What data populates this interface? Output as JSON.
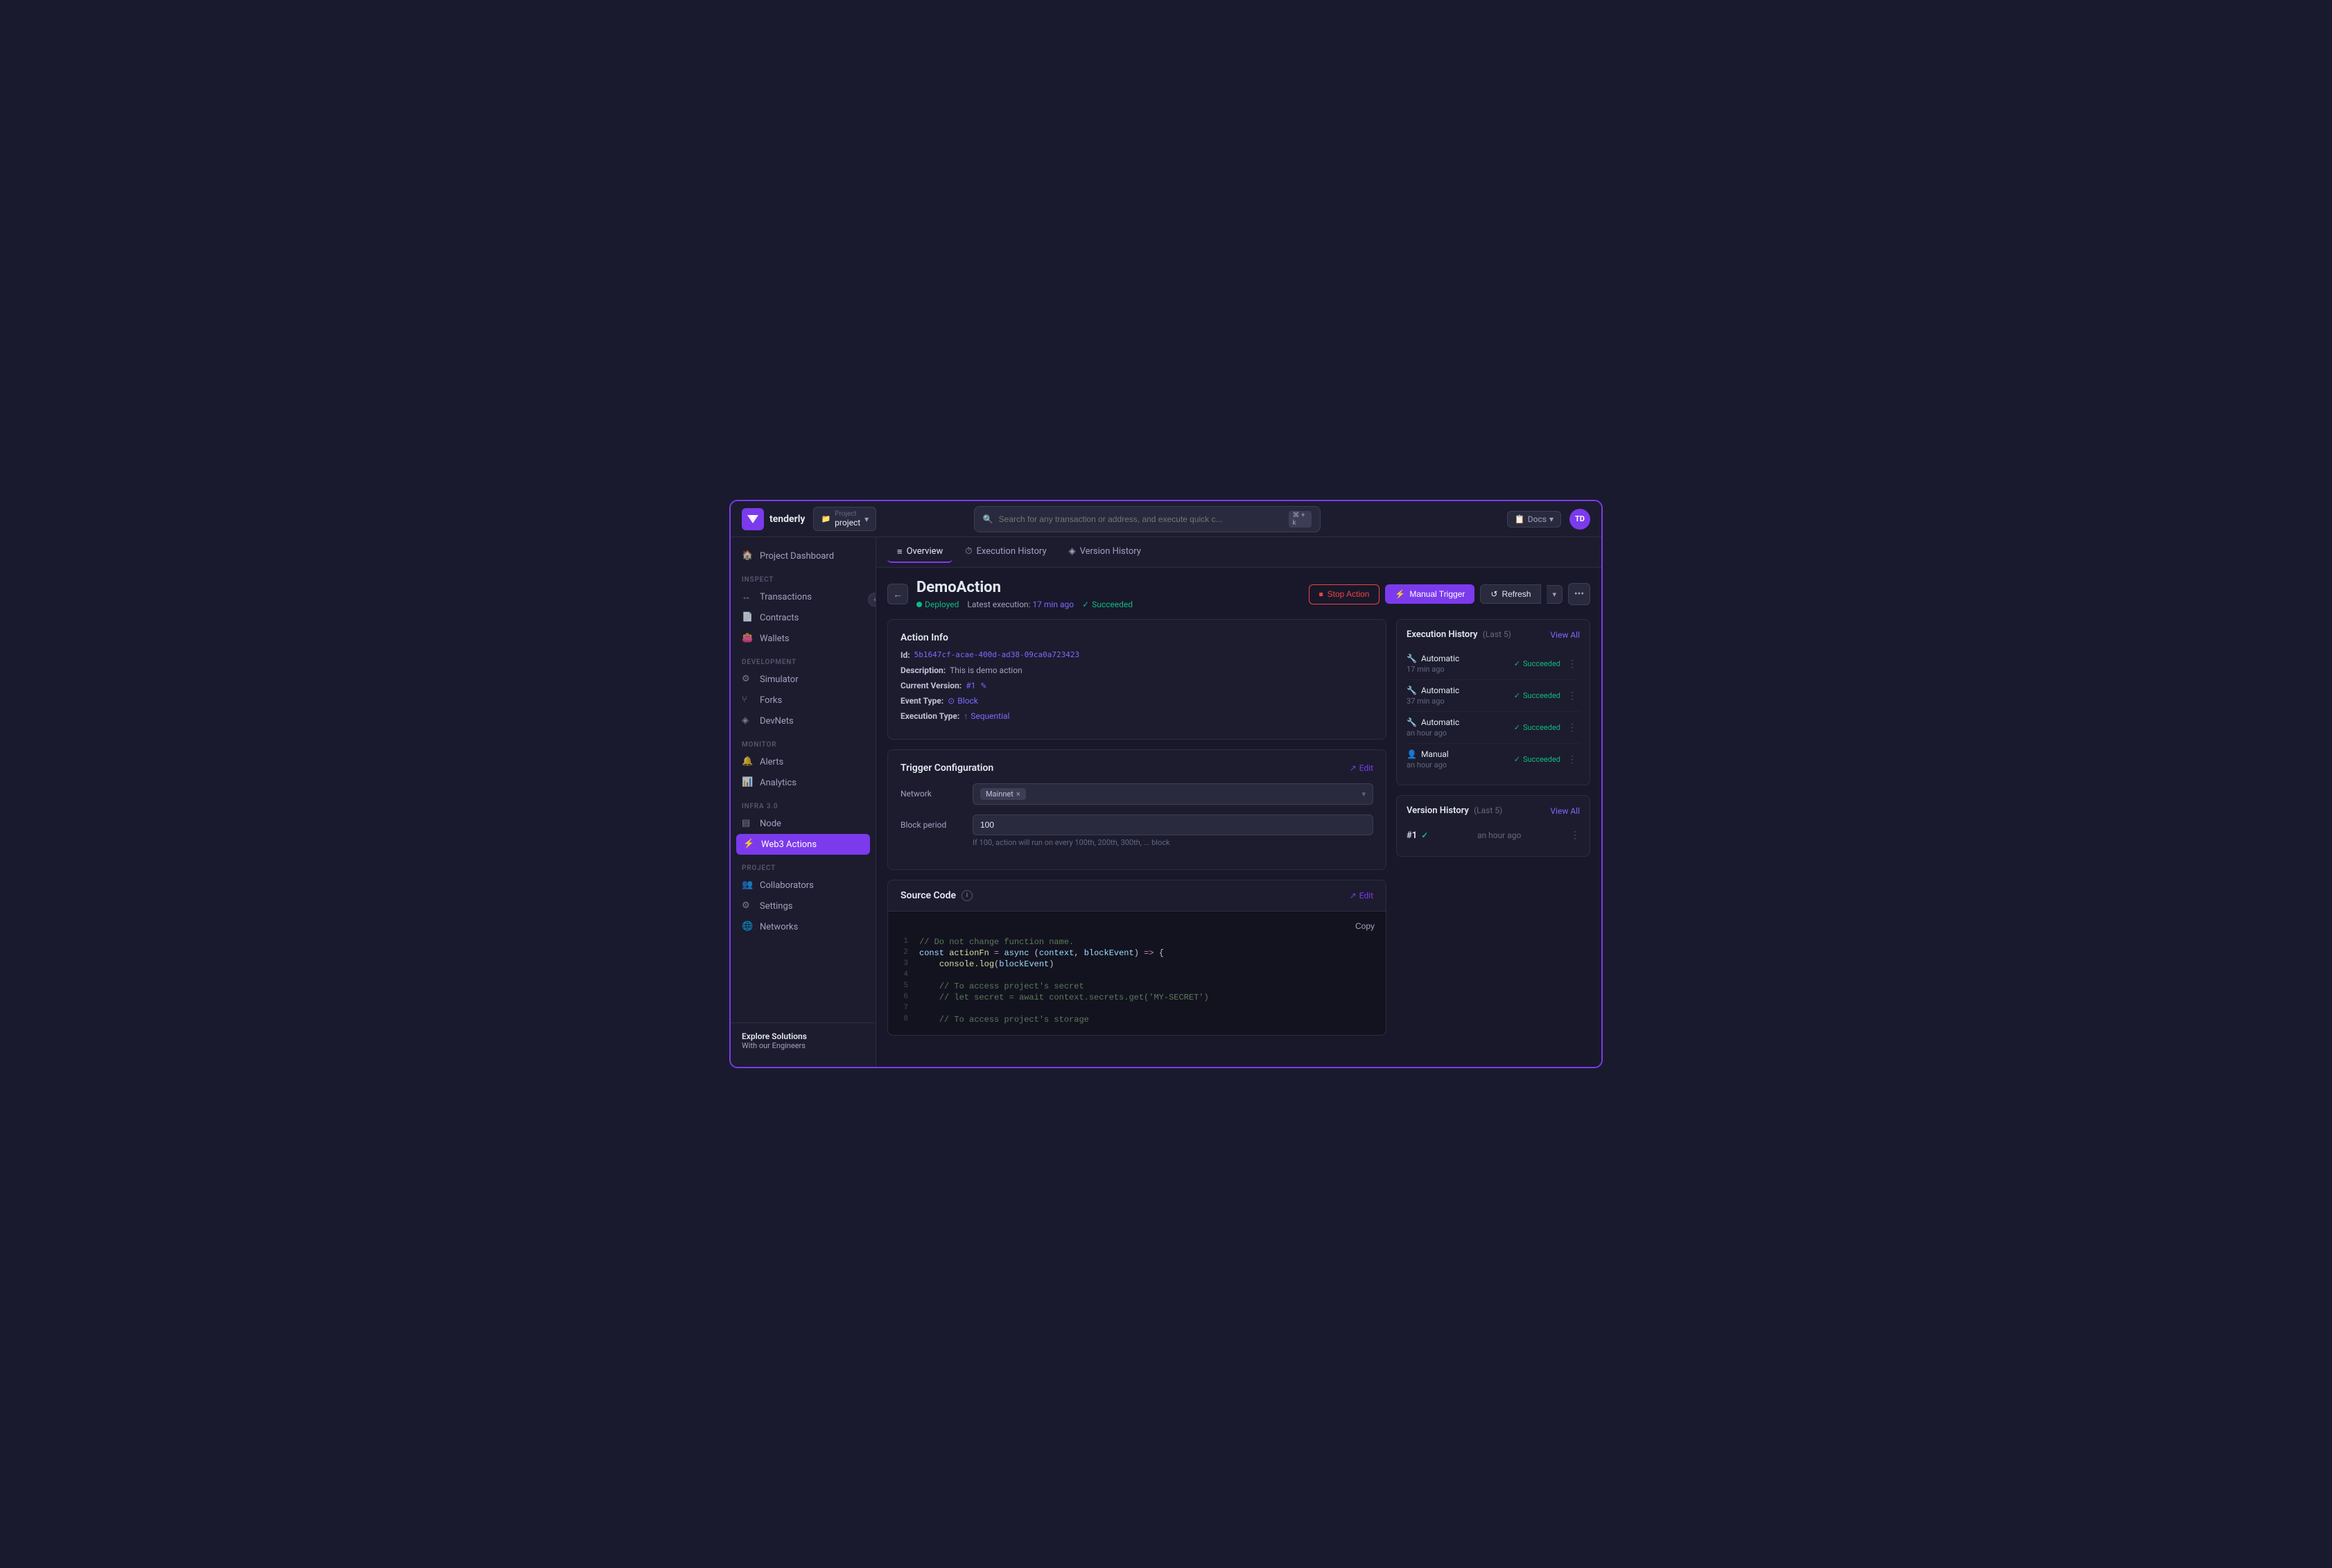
{
  "app": {
    "title": "Tenderly",
    "logo_text": "tenderly"
  },
  "project": {
    "label": "Project",
    "name": "project",
    "dropdown_icon": "▾"
  },
  "topbar": {
    "search_placeholder": "Search for any transaction or address, and execute quick c...",
    "keyboard_shortcut": "⌘ + k",
    "docs_label": "Docs",
    "docs_chevron": "▾",
    "avatar_initials": "TD"
  },
  "sidebar": {
    "collapse_icon": "‹",
    "sections": [
      {
        "label": "",
        "items": [
          {
            "id": "project-dashboard",
            "label": "Project Dashboard",
            "icon": "🏠"
          }
        ]
      },
      {
        "label": "Inspect",
        "items": [
          {
            "id": "transactions",
            "label": "Transactions",
            "icon": "↔"
          },
          {
            "id": "contracts",
            "label": "Contracts",
            "icon": "📄"
          },
          {
            "id": "wallets",
            "label": "Wallets",
            "icon": "👛"
          }
        ]
      },
      {
        "label": "Development",
        "items": [
          {
            "id": "simulator",
            "label": "Simulator",
            "icon": "⚙"
          },
          {
            "id": "forks",
            "label": "Forks",
            "icon": "⑂"
          },
          {
            "id": "devnets",
            "label": "DevNets",
            "icon": "◈"
          }
        ]
      },
      {
        "label": "Monitor",
        "items": [
          {
            "id": "alerts",
            "label": "Alerts",
            "icon": "🔔"
          },
          {
            "id": "analytics",
            "label": "Analytics",
            "icon": "📊"
          }
        ]
      },
      {
        "label": "Infra 3.0",
        "items": [
          {
            "id": "node",
            "label": "Node",
            "icon": "▤"
          },
          {
            "id": "web3-actions",
            "label": "Web3 Actions",
            "icon": "⚡",
            "active": true
          }
        ]
      },
      {
        "label": "Project",
        "items": [
          {
            "id": "collaborators",
            "label": "Collaborators",
            "icon": "👥"
          },
          {
            "id": "settings",
            "label": "Settings",
            "icon": "⚙"
          },
          {
            "id": "networks",
            "label": "Networks",
            "icon": "🌐"
          }
        ]
      }
    ],
    "explore": {
      "title": "Explore Solutions",
      "subtitle": "With our Engineers"
    }
  },
  "tabs": [
    {
      "id": "overview",
      "label": "Overview",
      "icon": "≡",
      "active": true
    },
    {
      "id": "execution-history",
      "label": "Execution History",
      "icon": "⏱"
    },
    {
      "id": "version-history",
      "label": "Version History",
      "icon": "◈"
    }
  ],
  "action": {
    "title": "DemoAction",
    "status": "Deployed",
    "latest_execution_label": "Latest execution:",
    "latest_execution_time": "17 min ago",
    "latest_execution_status": "Succeeded",
    "buttons": {
      "stop": "Stop Action",
      "trigger": "Manual Trigger",
      "refresh": "Refresh",
      "chevron": "▾",
      "more": "•••"
    }
  },
  "action_info": {
    "title": "Action Info",
    "id_label": "Id:",
    "id_value": "5b1647cf-acae-400d-ad38-09ca0a723423",
    "description_label": "Description:",
    "description_value": "This is demo action",
    "version_label": "Current Version:",
    "version_value": "#1",
    "event_type_label": "Event Type:",
    "event_type_value": "Block",
    "execution_type_label": "Execution Type:",
    "execution_type_value": "Sequential"
  },
  "trigger_config": {
    "title": "Trigger Configuration",
    "edit_label": "Edit",
    "network_label": "Network",
    "network_tag": "Mainnet",
    "network_tag_x": "×",
    "block_period_label": "Block period",
    "block_period_value": "100",
    "block_period_hint": "If 100, action will run on every 100th, 200th, 300th, ... block"
  },
  "source_code": {
    "title": "Source Code",
    "edit_label": "Edit",
    "copy_label": "Copy",
    "lines": [
      {
        "num": 1,
        "content": "// Do not change function name.",
        "type": "comment"
      },
      {
        "num": 2,
        "content": "const actionFn = async (context, blockEvent) => {",
        "type": "code"
      },
      {
        "num": 3,
        "content": "    console.log(blockEvent)",
        "type": "code"
      },
      {
        "num": 4,
        "content": "",
        "type": "empty"
      },
      {
        "num": 5,
        "content": "    // To access project's secret",
        "type": "comment"
      },
      {
        "num": 6,
        "content": "    // let secret = await context.secrets.get('MY-SECRET')",
        "type": "comment"
      },
      {
        "num": 7,
        "content": "",
        "type": "empty"
      },
      {
        "num": 8,
        "content": "    // To access project's storage",
        "type": "comment"
      }
    ]
  },
  "execution_history": {
    "title": "Execution History",
    "subtitle": "(Last 5)",
    "view_all": "View All",
    "items": [
      {
        "type": "Automatic",
        "time": "17 min ago",
        "status": "Succeeded"
      },
      {
        "type": "Automatic",
        "time": "37 min ago",
        "status": "Succeeded"
      },
      {
        "type": "Automatic",
        "time": "an hour ago",
        "status": "Succeeded"
      },
      {
        "type": "Manual",
        "time": "an hour ago",
        "status": "Succeeded"
      }
    ]
  },
  "version_history": {
    "title": "Version History",
    "subtitle": "(Last 5)",
    "view_all": "View All",
    "items": [
      {
        "num": "#1",
        "time": "an hour ago"
      }
    ]
  }
}
